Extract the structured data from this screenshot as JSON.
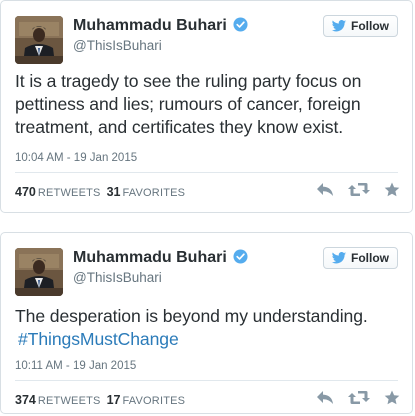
{
  "tweets": [
    {
      "name": "Muhammadu Buhari",
      "handle": "@ThisIsBuhari",
      "follow_label": "Follow",
      "text": "It is a tragedy to see the ruling party focus on pettiness and lies; rumours of cancer, foreign treatment, and certificates they know exist.",
      "hashtag": "",
      "timestamp": "10:04 AM - 19 Jan 2015",
      "retweets": "470",
      "retweets_label": "RETWEETS",
      "favorites": "31",
      "favorites_label": "FAVORITES"
    },
    {
      "name": "Muhammadu Buhari",
      "handle": "@ThisIsBuhari",
      "follow_label": "Follow",
      "text": "The desperation is beyond my understanding.",
      "hashtag": "#ThingsMustChange",
      "timestamp": "10:11 AM - 19 Jan 2015",
      "retweets": "374",
      "retweets_label": "RETWEETS",
      "favorites": "17",
      "favorites_label": "FAVORITES"
    }
  ],
  "icons": {
    "verified": "verified-badge-icon",
    "follow": "twitter-bird-icon",
    "reply": "reply-icon",
    "retweet": "retweet-icon",
    "favorite": "star-icon"
  },
  "colors": {
    "verified_blue": "#55acee",
    "bird_blue": "#55acee",
    "link_blue": "#2b7bb9",
    "text": "#292f33",
    "muted": "#66757f",
    "action_gray": "#8899a6"
  }
}
